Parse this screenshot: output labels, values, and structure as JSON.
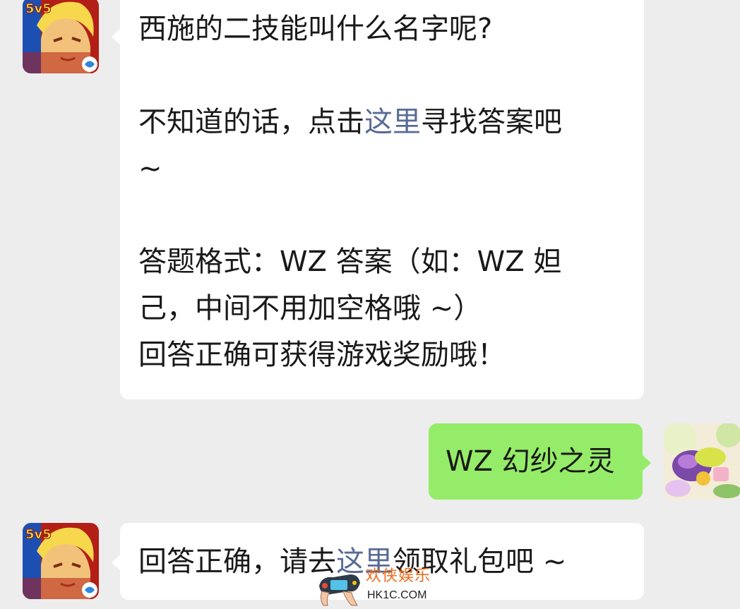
{
  "chat": {
    "messages": [
      {
        "sender": "game-account",
        "avatar_badge": "5v5",
        "line1": "西施的二技能叫什么名字呢?",
        "line2_before": "不知道的话，点击",
        "line2_link": "这里",
        "line2_after": "寻找答案吧",
        "line3": "~",
        "line4": "答题格式：WZ 答案（如：WZ 妲",
        "line5": "己，中间不用加空格哦 ~）",
        "line6": "回答正确可获得游戏奖励哦！"
      },
      {
        "sender": "me",
        "text": "WZ 幻纱之灵"
      },
      {
        "sender": "game-account",
        "avatar_badge": "5v5",
        "before": "回答正确，请去",
        "link": "这里",
        "after": "领取礼包吧 ~"
      }
    ]
  },
  "watermark": {
    "text": "欢侠娱乐",
    "domain": "HK1C.COM"
  },
  "colors": {
    "background": "#ededed",
    "incoming_bubble": "#ffffff",
    "outgoing_bubble": "#95ec69",
    "link": "#576b95",
    "watermark": "#ef6c1a"
  }
}
